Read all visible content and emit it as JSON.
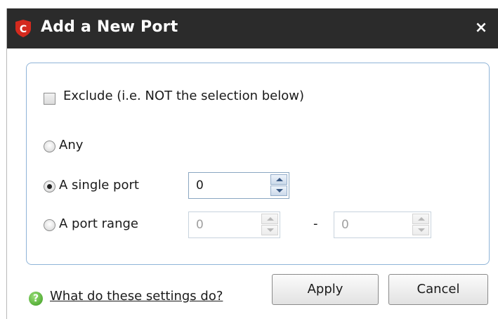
{
  "dialog": {
    "title": "Add a New Port",
    "close_glyph": "×",
    "logo_letter": "C",
    "accent_color": "#d42a1e"
  },
  "options": {
    "exclude_label": "Exclude (i.e. NOT the selection below)",
    "exclude_checked": false,
    "any_label": "Any",
    "single_label": "A single port",
    "range_label": "A port range",
    "selected": "single"
  },
  "fields": {
    "single_port_value": "0",
    "range_from_value": "0",
    "range_to_value": "0",
    "range_separator": "-"
  },
  "footer": {
    "help_text": "What do these settings do?",
    "help_icon": "question-icon",
    "apply_label": "Apply",
    "cancel_label": "Cancel"
  }
}
